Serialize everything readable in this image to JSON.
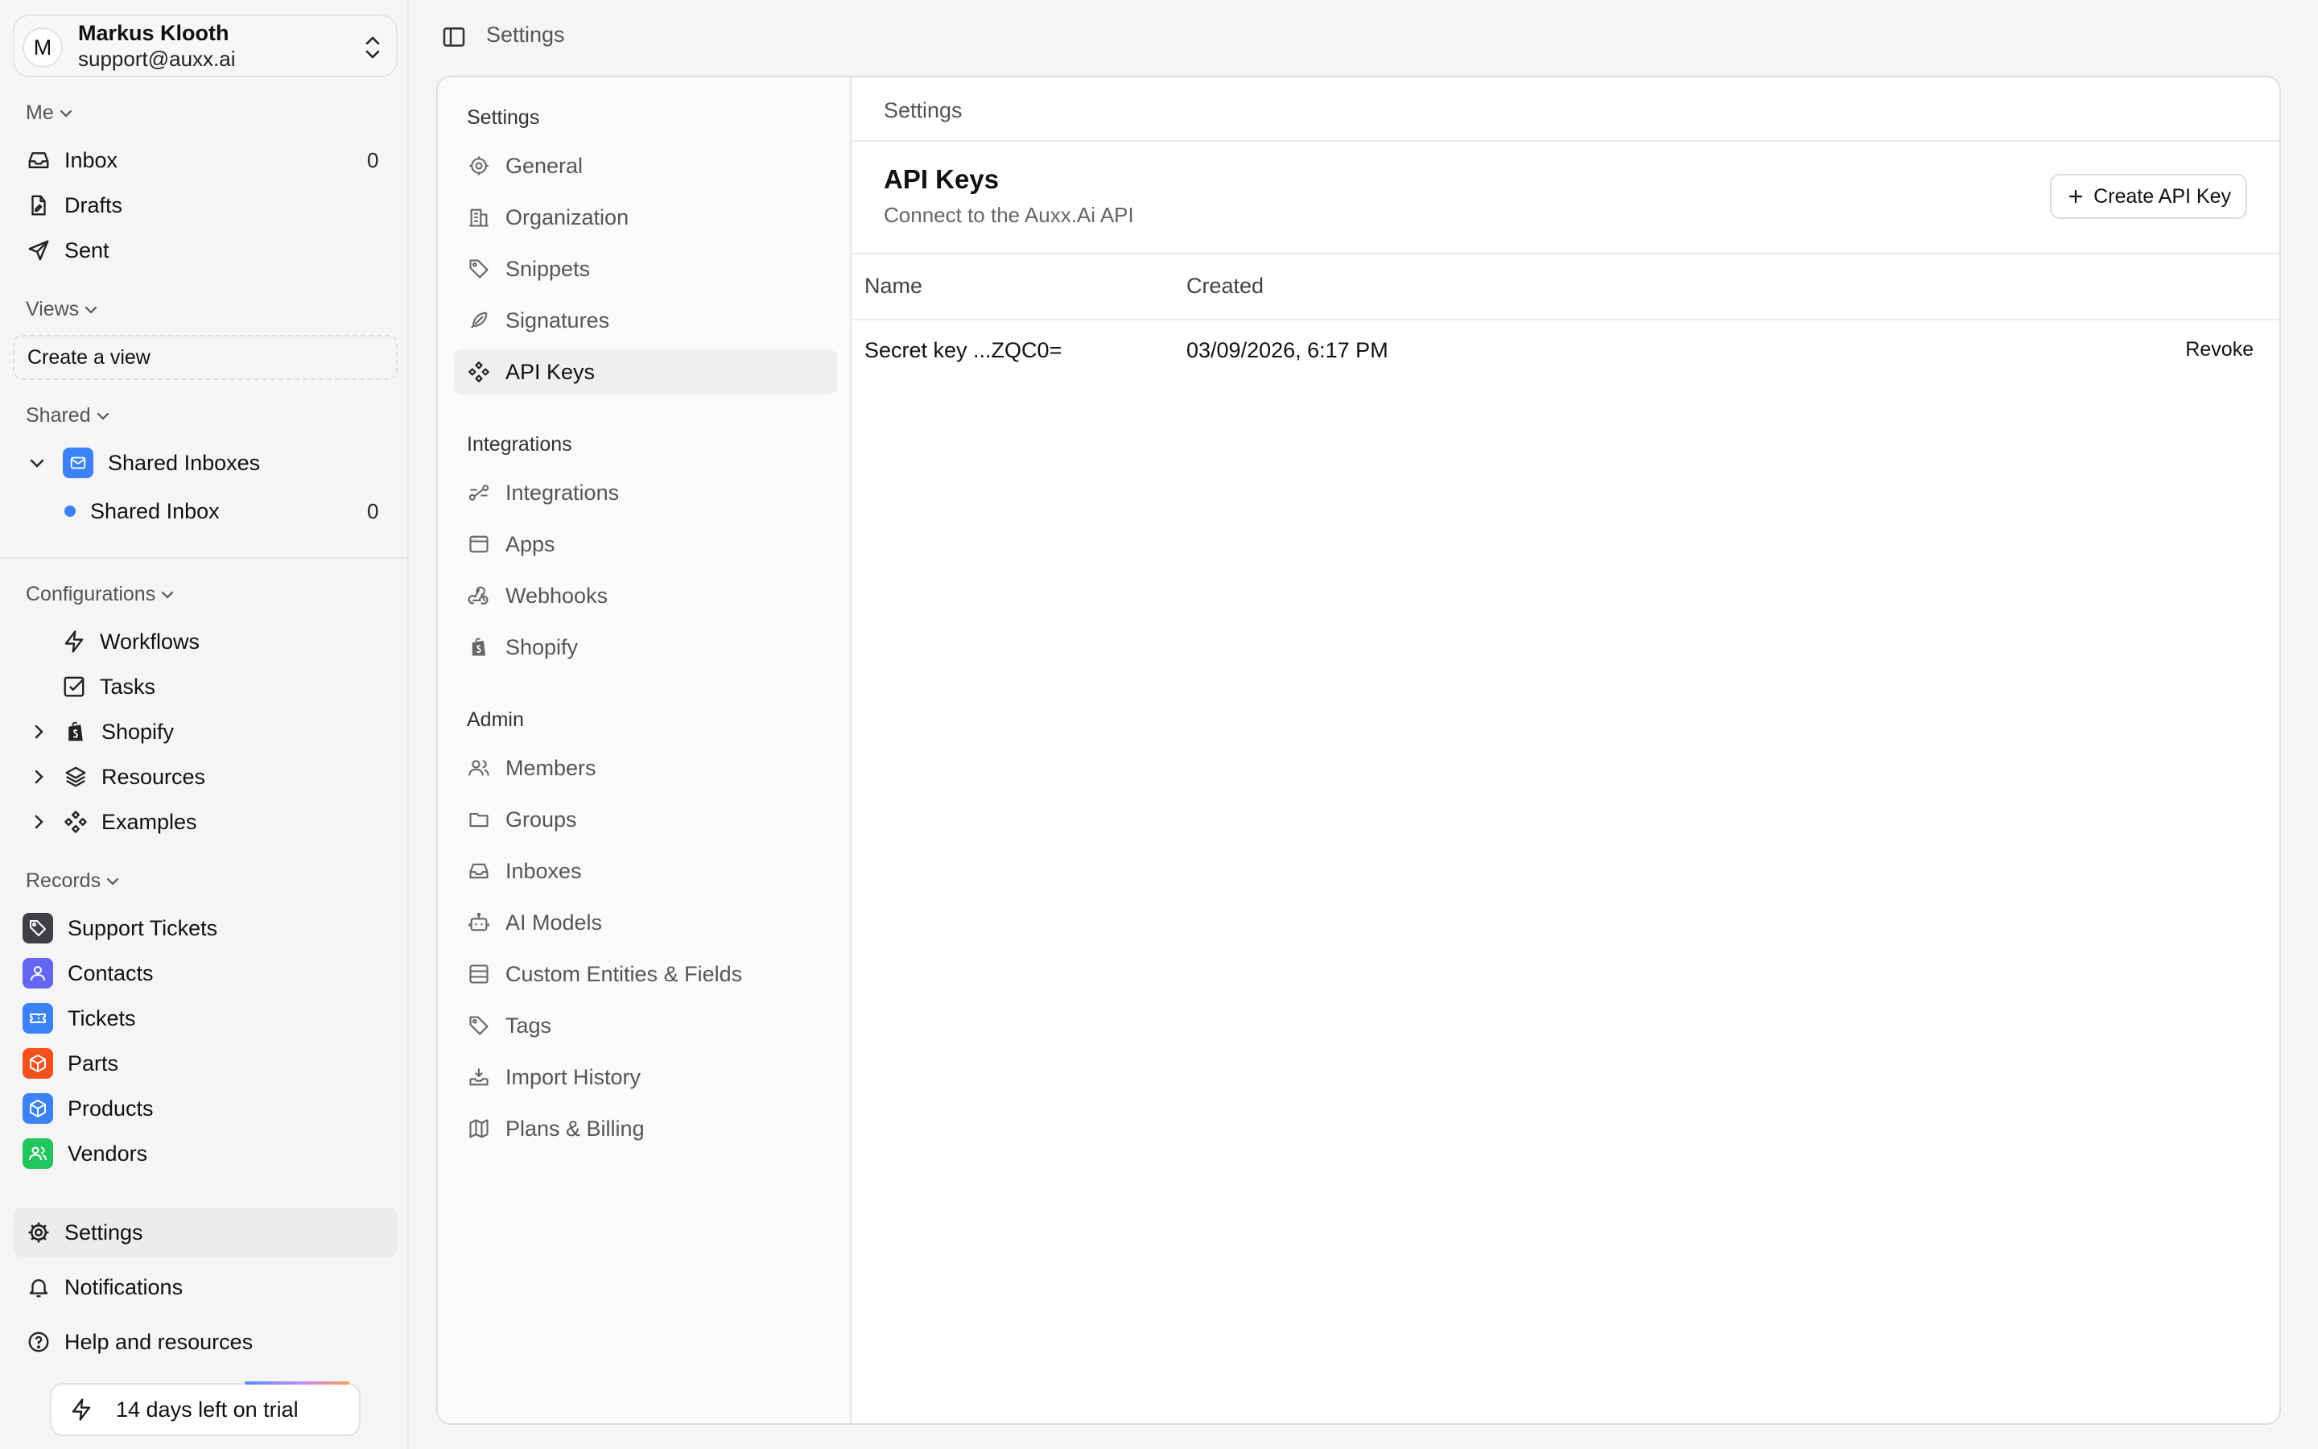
{
  "user": {
    "initial": "M",
    "name": "Markus Klooth",
    "email": "support@auxx.ai"
  },
  "sidebar": {
    "me_label": "Me",
    "me_items": [
      {
        "label": "Inbox",
        "count": "0"
      },
      {
        "label": "Drafts"
      },
      {
        "label": "Sent"
      }
    ],
    "views_label": "Views",
    "create_view": "Create a view",
    "shared_label": "Shared",
    "shared_group": "Shared Inboxes",
    "shared_inbox": {
      "label": "Shared Inbox",
      "count": "0"
    },
    "config_label": "Configurations",
    "config_items": [
      "Workflows",
      "Tasks",
      "Shopify",
      "Resources",
      "Examples"
    ],
    "records_label": "Records",
    "records": [
      "Support Tickets",
      "Contacts",
      "Tickets",
      "Parts",
      "Products",
      "Vendors"
    ],
    "bottom": [
      "Settings",
      "Notifications",
      "Help and resources"
    ],
    "trial": "14 days left on trial"
  },
  "topbar": {
    "title": "Settings"
  },
  "settings_nav": {
    "settings_head": "Settings",
    "settings_items": [
      "General",
      "Organization",
      "Snippets",
      "Signatures",
      "API Keys"
    ],
    "integrations_head": "Integrations",
    "integrations_items": [
      "Integrations",
      "Apps",
      "Webhooks",
      "Shopify"
    ],
    "admin_head": "Admin",
    "admin_items": [
      "Members",
      "Groups",
      "Inboxes",
      "AI Models",
      "Custom Entities & Fields",
      "Tags",
      "Import History",
      "Plans & Billing"
    ]
  },
  "content": {
    "breadcrumb": "Settings",
    "title": "API Keys",
    "subtitle": "Connect to the Auxx.Ai API",
    "create_button": "Create API Key",
    "columns": [
      "Name",
      "Created"
    ],
    "rows": [
      {
        "name": "Secret key ...ZQC0=",
        "created": "03/09/2026, 6:17 PM",
        "action": "Revoke"
      }
    ]
  },
  "colors": {
    "accent_blue": "#3b82f6",
    "support_tickets": "#3f3f46",
    "contacts": "#6366f1",
    "tickets": "#3b82f6",
    "parts": "#f4511e",
    "products": "#3b82f6",
    "vendors": "#22c55e"
  }
}
